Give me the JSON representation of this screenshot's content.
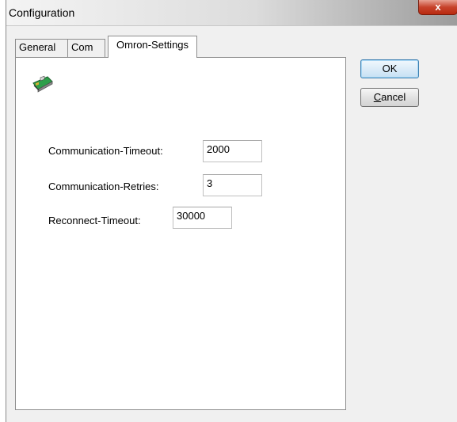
{
  "window": {
    "title": "Configuration",
    "close_label": "x"
  },
  "tabs": [
    {
      "label": "General",
      "active": false
    },
    {
      "label": "Com",
      "active": false
    },
    {
      "label": "Omron-Settings",
      "active": true
    }
  ],
  "buttons": {
    "ok_label": "OK",
    "cancel_prefix": "C",
    "cancel_rest": "ancel"
  },
  "fields": {
    "comm_timeout": {
      "label": "Communication-Timeout:",
      "value": "2000"
    },
    "comm_retries": {
      "label": "Communication-Retries:",
      "value": "3"
    },
    "reconnect_timeout": {
      "label": "Reconnect-Timeout:",
      "value": "30000"
    }
  },
  "icon": "network-card-icon"
}
